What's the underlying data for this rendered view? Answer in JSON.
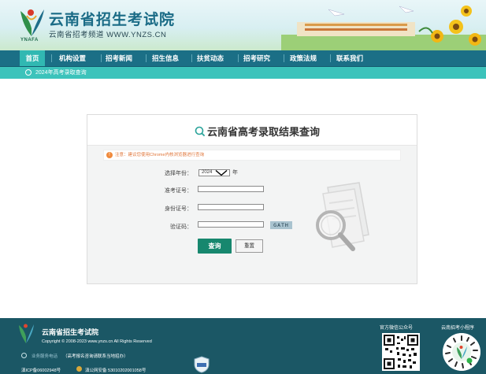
{
  "header": {
    "site_title": "云南省招生考试院",
    "site_subtitle": "云南省招考频道 WWW.YNZS.CN",
    "logo_text": "YNAFA"
  },
  "nav": {
    "items": [
      {
        "label": "首页",
        "active": true
      },
      {
        "label": "机构设置"
      },
      {
        "label": "招考新闻"
      },
      {
        "label": "招生信息"
      },
      {
        "label": "扶贫动态"
      },
      {
        "label": "招考研究"
      },
      {
        "label": "政策法规"
      },
      {
        "label": "联系我们"
      }
    ]
  },
  "subnav": {
    "link": "2024年高考录取查询"
  },
  "panel": {
    "title": "云南省高考录取结果查询",
    "notice": "注意：建议您使用Chrome内核浏览器进行查询",
    "year_label": "选择年份：",
    "year_value": "2024",
    "year_unit": "年",
    "exam_no_label": "准考证号：",
    "exam_no_value": "",
    "id_no_label": "身份证号：",
    "id_no_value": "",
    "captcha_label": "验证码：",
    "captcha_value": "",
    "captcha_image_text": "GATH",
    "query_button": "查询",
    "reset_button": "重置"
  },
  "footer": {
    "title": "云南省招生考试院",
    "copyright": "Copyright © 2008-2023 www.ynzs.cn All Rights Reserved",
    "phone_label": "业务服务电话",
    "phone_note": "（高考报名咨询请联系当地招办）",
    "icp": "滇ICP备06002948号",
    "police": "滇公网安备 53010202001058号",
    "wechat_label": "官方微信公众号",
    "miniprogram_label": "云南招考小程序"
  },
  "colors": {
    "nav_bg": "#1b6f86",
    "nav_active": "#31b8b2",
    "subnav_bg": "#3cc3bb",
    "query_button": "#17876e",
    "footer_bg": "#1b5765",
    "title_blue": "#1a6b86"
  }
}
